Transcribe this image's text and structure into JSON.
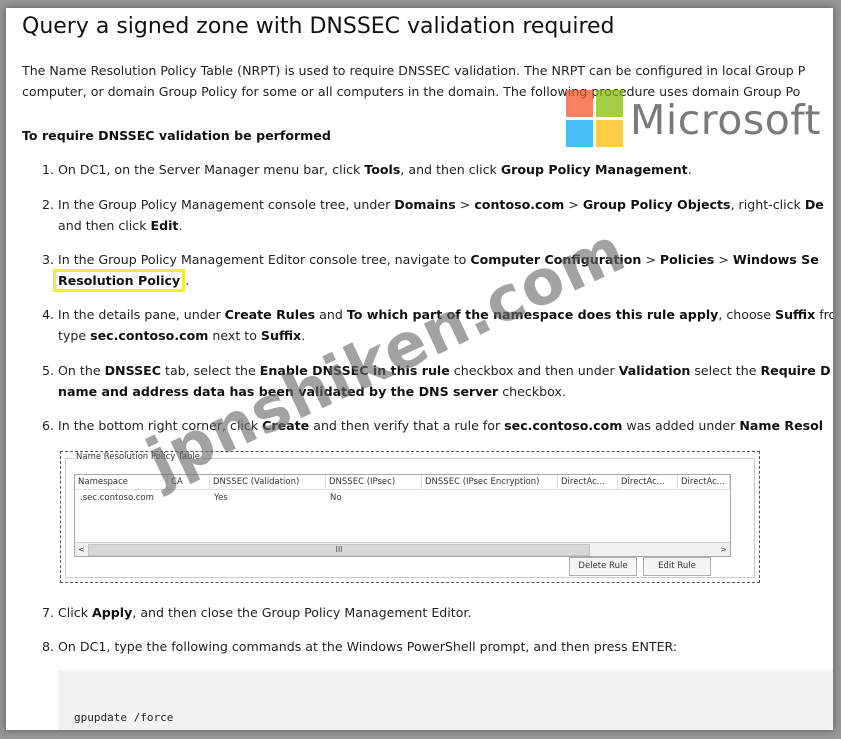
{
  "title": "Query a signed zone with DNSSEC validation required",
  "intro": {
    "line1": "The Name Resolution Policy Table (NRPT) is used to require DNSSEC validation. The NRPT can be configured in local Group P",
    "line2": "computer, or domain Group Policy for some or all computers in the domain. The following procedure uses domain Group Po"
  },
  "subheading": "To require DNSSEC validation be performed",
  "steps": {
    "s1": {
      "num": "1.",
      "a": "On DC1, on the Server Manager menu bar, click ",
      "b": "Tools",
      "c": ", and then click ",
      "d": "Group Policy Management",
      "e": "."
    },
    "s2": {
      "num": "2.",
      "a": "In the Group Policy Management console tree, under ",
      "b": "Domains",
      "c": " > ",
      "d": "contoso.com",
      "e": " > ",
      "f": "Group Policy Objects",
      "g": ", right-click ",
      "h": "De",
      "i": "and then click ",
      "j": "Edit",
      "k": "."
    },
    "s3": {
      "num": "3.",
      "a": "In the Group Policy Management Editor console tree, navigate to ",
      "b": "Computer Configuration",
      "c": " > ",
      "d": "Policies",
      "e": " > ",
      "f": "Windows Se",
      "g": "Resolution Policy",
      "h": "."
    },
    "s4": {
      "num": "4.",
      "a": "In the details pane, under ",
      "b": "Create Rules",
      "c": " and ",
      "d": "To which part of the namespace does this rule apply",
      "e": ", choose ",
      "f": "Suffix",
      "g": " fro",
      "h": "type ",
      "i": "sec.contoso.com",
      "j": " next to ",
      "k": "Suffix",
      "l": "."
    },
    "s5": {
      "num": "5.",
      "a": "On the ",
      "b": "DNSSEC",
      "c": " tab, select the ",
      "d": "Enable DNSSEC in this rule",
      "e": " checkbox and then under ",
      "f": "Validation",
      "g": " select the ",
      "h": "Require D",
      "i": "name and address data has been validated by the DNS server",
      "j": " checkbox."
    },
    "s6": {
      "num": "6.",
      "a": "In the bottom right corner, click ",
      "b": "Create",
      "c": " and then verify that a rule for ",
      "d": "sec.contoso.com",
      "e": " was added under ",
      "f": "Name Resol"
    },
    "s7": {
      "num": "7.",
      "a": "Click ",
      "b": "Apply",
      "c": ", and then close the Group Policy Management Editor."
    },
    "s8": {
      "num": "8.",
      "a": "On DC1, type the following commands at the Windows PowerShell prompt, and then press ENTER:"
    }
  },
  "nrpt_dialog": {
    "group_title": "Name Resolution Policy Table",
    "columns": [
      "Namespace",
      "CA",
      "DNSSEC (Validation)",
      "DNSSEC (IPsec)",
      "DNSSEC (IPsec Encryption)",
      "DirectAc...",
      "DirectAc...",
      "DirectAc..."
    ],
    "row": {
      "namespace": ".sec.contoso.com",
      "validation": "Yes",
      "ipsec": "No"
    },
    "scroll_left": "<",
    "scroll_thumb": "III",
    "scroll_right": ">",
    "delete_button": "Delete Rule",
    "edit_button": "Edit Rule"
  },
  "code": "gpupdate /force",
  "logo": {
    "text": "Microsoft",
    "colors": [
      "#f25022",
      "#7fba00",
      "#00a4ef",
      "#ffb900"
    ]
  },
  "watermark": "jpnshiken.com"
}
